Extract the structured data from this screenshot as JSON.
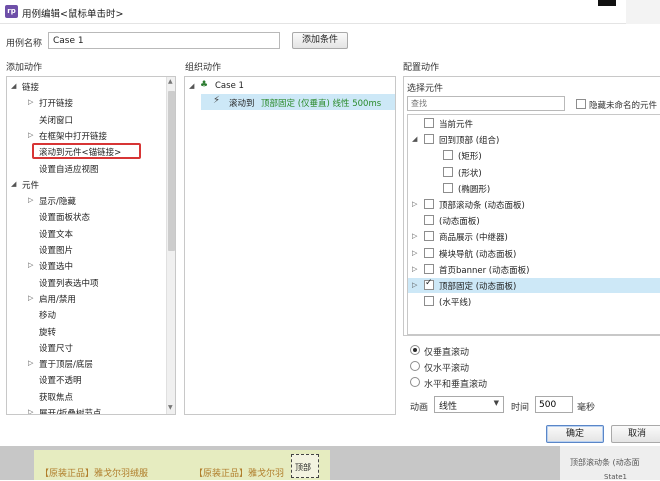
{
  "window": {
    "title": "用例编辑<鼠标单击时>",
    "icon": "axure-app-icon"
  },
  "case_name": {
    "label": "用例名称",
    "value": "Case 1",
    "add_condition": "添加条件"
  },
  "add_action": {
    "heading": "添加动作",
    "items": [
      {
        "label": "链接",
        "expander": "expanded"
      },
      {
        "label": "打开链接",
        "expander": "collapsed"
      },
      {
        "label": "关闭窗口",
        "expander": ""
      },
      {
        "label": "在框架中打开链接",
        "expander": "collapsed"
      },
      {
        "label": "滚动到元件<锚链接>",
        "expander": ""
      },
      {
        "label": "设置自适应视图",
        "expander": ""
      },
      {
        "label": "元件",
        "expander": "expanded"
      },
      {
        "label": "显示/隐藏",
        "expander": "collapsed"
      },
      {
        "label": "设置面板状态",
        "expander": ""
      },
      {
        "label": "设置文本",
        "expander": ""
      },
      {
        "label": "设置图片",
        "expander": ""
      },
      {
        "label": "设置选中",
        "expander": "collapsed"
      },
      {
        "label": "设置列表选中项",
        "expander": ""
      },
      {
        "label": "启用/禁用",
        "expander": "collapsed"
      },
      {
        "label": "移动",
        "expander": ""
      },
      {
        "label": "旋转",
        "expander": ""
      },
      {
        "label": "设置尺寸",
        "expander": ""
      },
      {
        "label": "置于顶层/底层",
        "expander": "collapsed"
      },
      {
        "label": "设置不透明",
        "expander": ""
      },
      {
        "label": "获取焦点",
        "expander": ""
      },
      {
        "label": "展开/折叠树节点",
        "expander": "collapsed"
      }
    ]
  },
  "organize": {
    "heading": "组织动作",
    "case_label": "Case 1",
    "action_label": "滚动到",
    "action_target": "顶部固定 (仅垂直) 线性 500ms"
  },
  "configure": {
    "heading": "配置动作",
    "select_widget": "选择元件",
    "search_placeholder": "查找",
    "hide_unnamed": "隐藏未命名的元件",
    "widgets": [
      {
        "label": "当前元件",
        "checked": false,
        "expander": ""
      },
      {
        "label": "回到顶部 (组合)",
        "checked": false,
        "expander": "expanded"
      },
      {
        "label": "(矩形)",
        "checked": false,
        "expander": ""
      },
      {
        "label": "(形状)",
        "checked": false,
        "expander": ""
      },
      {
        "label": "(椭圆形)",
        "checked": false,
        "expander": ""
      },
      {
        "label": "顶部滚动条 (动态面板)",
        "checked": false,
        "expander": "collapsed"
      },
      {
        "label": "(动态面板)",
        "checked": false,
        "expander": ""
      },
      {
        "label": "商品展示 (中继器)",
        "checked": false,
        "expander": "collapsed"
      },
      {
        "label": "模块导航 (动态面板)",
        "checked": false,
        "expander": "collapsed"
      },
      {
        "label": "首页banner (动态面板)",
        "checked": false,
        "expander": "collapsed"
      },
      {
        "label": "顶部固定 (动态面板)",
        "checked": true,
        "expander": "collapsed"
      },
      {
        "label": "(水平线)",
        "checked": false,
        "expander": ""
      }
    ],
    "scroll_options": [
      {
        "label": "仅垂直滚动",
        "checked": true
      },
      {
        "label": "仅水平滚动",
        "checked": false
      },
      {
        "label": "水平和垂直滚动",
        "checked": false
      }
    ],
    "animation_label": "动画",
    "animation_value": "线性",
    "time_label": "时间",
    "time_value": "500",
    "ms_label": "毫秒"
  },
  "buttons": {
    "ok": "确定",
    "cancel": "取消"
  },
  "background": {
    "text1": "【原装正品】雅戈尔羽绒服",
    "text2": "【原装正品】雅戈尔羽",
    "handle_label": "顶部",
    "side_item1": "顶部滚动条 (动态面",
    "side_item2": "State1"
  },
  "colors": {
    "selection": "#cde8f7",
    "accent": "#2a8a2a",
    "highlight_border": "#d73535"
  }
}
